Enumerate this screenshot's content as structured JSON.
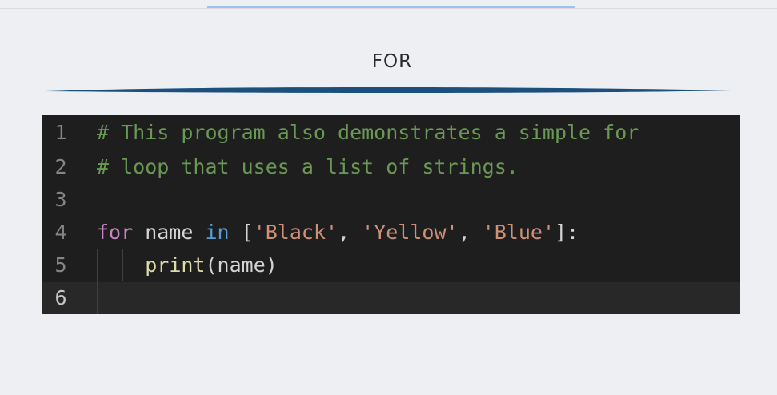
{
  "page": {
    "title": "FOR"
  },
  "colors": {
    "background": "#eeeff2",
    "accent_bar": "#9dc3ea",
    "brush_stroke": "#1b4f7e",
    "editor_background": "#1e1e1e",
    "comment": "#6a9955",
    "keyword": "#c586c0",
    "builtin_keyword": "#569cd6",
    "string": "#ce9178",
    "function": "#dcdcaa",
    "text": "#d4d4d4",
    "line_number": "#858585"
  },
  "code": {
    "language": "python",
    "current_line": 6,
    "lines": [
      {
        "number": "1",
        "tokens": [
          {
            "text": "# This program also demonstrates a simple for",
            "type": "comment"
          }
        ]
      },
      {
        "number": "2",
        "tokens": [
          {
            "text": "# loop that uses a list of strings.",
            "type": "comment"
          }
        ]
      },
      {
        "number": "3",
        "tokens": []
      },
      {
        "number": "4",
        "tokens": [
          {
            "text": "for",
            "type": "keyword"
          },
          {
            "text": " name ",
            "type": "ident"
          },
          {
            "text": "in",
            "type": "keyword2"
          },
          {
            "text": " [",
            "type": "punct"
          },
          {
            "text": "'Black'",
            "type": "string"
          },
          {
            "text": ", ",
            "type": "punct"
          },
          {
            "text": "'Yellow'",
            "type": "string"
          },
          {
            "text": ", ",
            "type": "punct"
          },
          {
            "text": "'Blue'",
            "type": "string"
          },
          {
            "text": "]:",
            "type": "punct"
          }
        ]
      },
      {
        "number": "5",
        "tokens": [
          {
            "text": "    ",
            "type": "ident"
          },
          {
            "text": "print",
            "type": "func"
          },
          {
            "text": "(name)",
            "type": "punct"
          }
        ]
      },
      {
        "number": "6",
        "tokens": []
      }
    ]
  }
}
